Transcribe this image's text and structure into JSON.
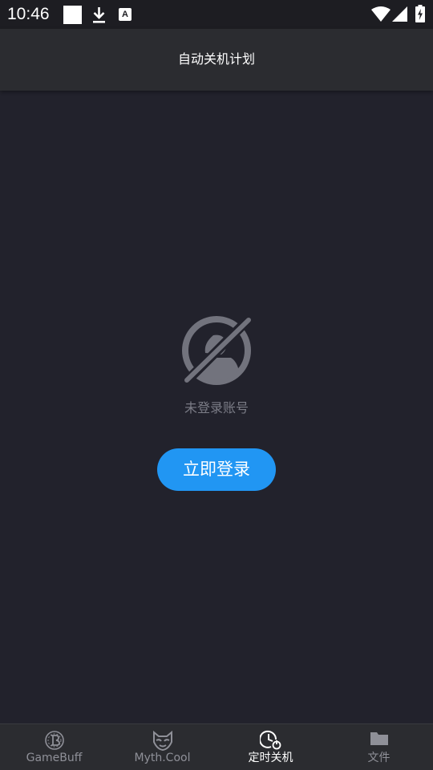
{
  "status_bar": {
    "time": "10:46",
    "notif_icon_letter": "A"
  },
  "app_bar": {
    "title": "自动关机计划"
  },
  "main": {
    "empty_icon": "user-off-icon",
    "empty_text": "未登录账号",
    "login_button": "立即登录"
  },
  "bottom_nav": {
    "items": [
      {
        "label": "GameBuff",
        "icon": "gamebuff-icon",
        "active": false
      },
      {
        "label": "Myth.Cool",
        "icon": "fox-icon",
        "active": false
      },
      {
        "label": "定时关机",
        "icon": "timer-power-icon",
        "active": true
      },
      {
        "label": "文件",
        "icon": "folder-icon",
        "active": false
      }
    ]
  },
  "colors": {
    "background": "#22222c",
    "app_bar": "#2b2c30",
    "accent": "#2196f3",
    "muted_text": "#7b7c86"
  }
}
